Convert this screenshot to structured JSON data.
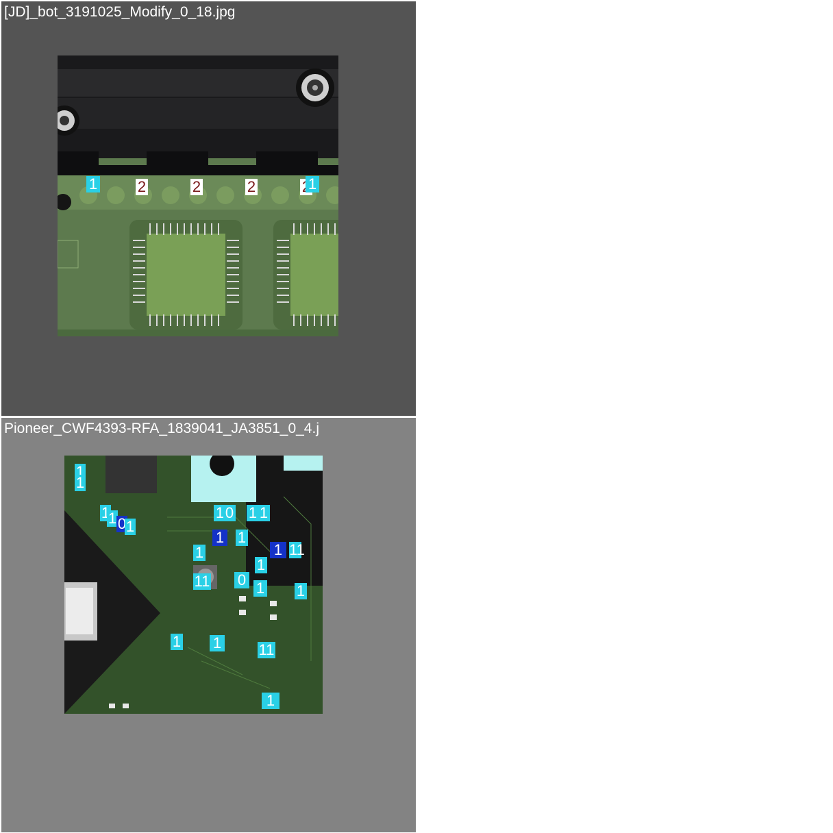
{
  "panels": [
    {
      "filename": "[JD]_bot_3191025_Modify_0_18.jpg"
    },
    {
      "filename": "Pioneer_CWF4393-RFA_1839041_JA3851_0_4.j"
    }
  ],
  "colors": {
    "panel1_bg": "#545454",
    "panel2_bg": "#838383",
    "label_cyan": "#2ad0e6",
    "label_blue": "#1432c8"
  },
  "panel1_labels": [
    "1",
    "2",
    "2",
    "2",
    "2",
    "1"
  ],
  "panel2_labels": [
    "1",
    "1",
    "1",
    "1",
    "0",
    "1",
    "1",
    "0",
    "1",
    "1",
    "1",
    "1",
    "1",
    "11",
    "1",
    "11",
    "1",
    "0",
    "1",
    "1",
    "1",
    "1",
    "11",
    "1"
  ]
}
